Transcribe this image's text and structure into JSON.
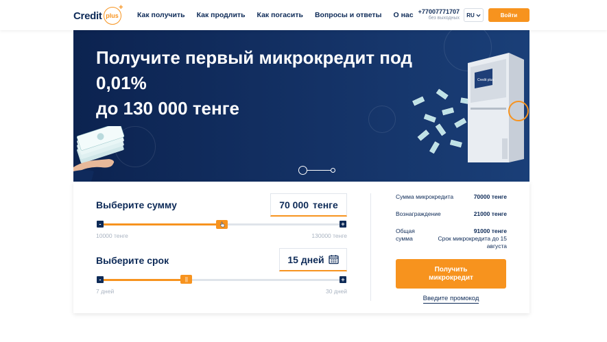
{
  "header": {
    "logo_text": "Credit",
    "logo_circle_text": "plus",
    "nav": [
      "Как получить",
      "Как продлить",
      "Как погасить",
      "Вопросы и ответы",
      "О нас"
    ],
    "phone": "+77007771707",
    "phone_sub": "без выходных",
    "lang": "RU",
    "login_label": "Войти"
  },
  "hero": {
    "title_line1": "Получите первый микрокредит под",
    "title_line2": "0,01%",
    "title_line3": "до 130 000 тенге",
    "atm_brand": "Credit plus"
  },
  "calculator": {
    "amount_label": "Выберите сумму",
    "amount_value": "70 000",
    "amount_unit": "тенге",
    "amount_min": "10000 тенге",
    "amount_max": "130000 тенге",
    "amount_level": 0.5,
    "term_label": "Выберите срок",
    "term_value": "15 дней",
    "term_min": "7 дней",
    "term_max": "30 дней",
    "term_level": 0.35,
    "minus": "-",
    "plus": "+"
  },
  "summary": {
    "sum_label": "Сумма микрокредита",
    "sum_value": "70000 тенге",
    "reward_label": "Вознаграждение",
    "reward_value": "21000 тенге",
    "total_label_1": "Общая",
    "total_label_2": "сумма",
    "total_value": "91000 тенге",
    "term_text_1": "Срок микрокредита до 15",
    "term_text_2": "августа",
    "cta_line1": "Получить",
    "cta_line2": "микрокредит",
    "promo": "Введите промокод"
  },
  "colors": {
    "accent": "#f7931e",
    "navy": "#0d2a57",
    "hero_bg": "#143266"
  }
}
